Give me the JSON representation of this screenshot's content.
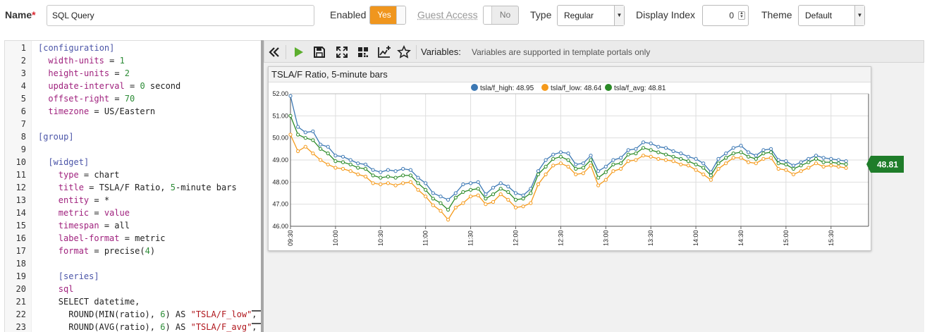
{
  "form": {
    "name_label": "Name",
    "required_mark": "*",
    "name_value": "SQL Query",
    "enabled_label": "Enabled",
    "enabled_value": "Yes",
    "guest_label": "Guest Access",
    "guest_value": "No",
    "type_label": "Type",
    "type_value": "Regular",
    "display_index_label": "Display Index",
    "display_index_value": "0",
    "theme_label": "Theme",
    "theme_value": "Default"
  },
  "editor": {
    "lines": [
      {
        "n": "1",
        "indent": 0,
        "parts": [
          {
            "t": "[configuration]",
            "c": "k-sec"
          }
        ]
      },
      {
        "n": "2",
        "indent": 1,
        "parts": [
          {
            "t": "width-units",
            "c": "k-key"
          },
          {
            "t": " = ",
            "c": ""
          },
          {
            "t": "1",
            "c": "k-num"
          }
        ]
      },
      {
        "n": "3",
        "indent": 1,
        "parts": [
          {
            "t": "height-units",
            "c": "k-key"
          },
          {
            "t": " = ",
            "c": ""
          },
          {
            "t": "2",
            "c": "k-num"
          }
        ]
      },
      {
        "n": "4",
        "indent": 1,
        "parts": [
          {
            "t": "update-interval",
            "c": "k-key"
          },
          {
            "t": " = ",
            "c": ""
          },
          {
            "t": "0",
            "c": "k-num"
          },
          {
            "t": " second",
            "c": ""
          }
        ]
      },
      {
        "n": "5",
        "indent": 1,
        "parts": [
          {
            "t": "offset-right",
            "c": "k-key"
          },
          {
            "t": " = ",
            "c": ""
          },
          {
            "t": "70",
            "c": "k-num"
          }
        ]
      },
      {
        "n": "6",
        "indent": 1,
        "parts": [
          {
            "t": "timezone",
            "c": "k-key"
          },
          {
            "t": " = US/Eastern",
            "c": ""
          }
        ]
      },
      {
        "n": "7",
        "indent": 0,
        "parts": []
      },
      {
        "n": "8",
        "indent": 0,
        "parts": [
          {
            "t": "[group]",
            "c": "k-sec"
          }
        ]
      },
      {
        "n": "9",
        "indent": 0,
        "parts": []
      },
      {
        "n": "10",
        "indent": 1,
        "parts": [
          {
            "t": "[widget]",
            "c": "k-sec"
          }
        ]
      },
      {
        "n": "11",
        "indent": 2,
        "parts": [
          {
            "t": "type",
            "c": "k-key"
          },
          {
            "t": " = chart",
            "c": ""
          }
        ]
      },
      {
        "n": "12",
        "indent": 2,
        "parts": [
          {
            "t": "title",
            "c": "k-key"
          },
          {
            "t": " = TSLA/F Ratio, ",
            "c": ""
          },
          {
            "t": "5",
            "c": "k-num"
          },
          {
            "t": "-minute bars",
            "c": ""
          }
        ]
      },
      {
        "n": "13",
        "indent": 2,
        "parts": [
          {
            "t": "entity",
            "c": "k-key"
          },
          {
            "t": " = *",
            "c": ""
          }
        ]
      },
      {
        "n": "14",
        "indent": 2,
        "parts": [
          {
            "t": "metric",
            "c": "k-key"
          },
          {
            "t": " = ",
            "c": ""
          },
          {
            "t": "value",
            "c": "k-kw"
          }
        ]
      },
      {
        "n": "15",
        "indent": 2,
        "parts": [
          {
            "t": "timespan",
            "c": "k-key"
          },
          {
            "t": " = all",
            "c": ""
          }
        ]
      },
      {
        "n": "16",
        "indent": 2,
        "parts": [
          {
            "t": "label-format",
            "c": "k-key"
          },
          {
            "t": " = metric",
            "c": ""
          }
        ]
      },
      {
        "n": "17",
        "indent": 2,
        "parts": [
          {
            "t": "format",
            "c": "k-key"
          },
          {
            "t": " = precise(",
            "c": ""
          },
          {
            "t": "4",
            "c": "k-num"
          },
          {
            "t": ")",
            "c": ""
          }
        ]
      },
      {
        "n": "18",
        "indent": 0,
        "parts": []
      },
      {
        "n": "19",
        "indent": 2,
        "parts": [
          {
            "t": "[series]",
            "c": "k-sec"
          }
        ]
      },
      {
        "n": "20",
        "indent": 2,
        "parts": [
          {
            "t": "sql",
            "c": "k-key"
          }
        ]
      },
      {
        "n": "21",
        "indent": 2,
        "parts": [
          {
            "t": "SELECT datetime,",
            "c": ""
          }
        ]
      },
      {
        "n": "22",
        "indent": 3,
        "parts": [
          {
            "t": "ROUND(MIN(ratio), ",
            "c": ""
          },
          {
            "t": "6",
            "c": "k-num"
          },
          {
            "t": ") AS ",
            "c": ""
          },
          {
            "t": "\"TSLA/F_low\"",
            "c": "k-str"
          },
          {
            "t": ",",
            "c": ""
          }
        ]
      },
      {
        "n": "23",
        "indent": 3,
        "parts": [
          {
            "t": "ROUND(AVG(ratio), ",
            "c": ""
          },
          {
            "t": "6",
            "c": "k-num"
          },
          {
            "t": ") AS ",
            "c": ""
          },
          {
            "t": "\"TSLA/F_avg\"",
            "c": "k-str"
          },
          {
            "t": ",",
            "c": ""
          }
        ]
      }
    ]
  },
  "toolbar": {
    "icons": [
      "collapse-icon",
      "play-icon",
      "save-icon",
      "fullscreen-icon",
      "grid-icon",
      "add-series-icon",
      "star-icon"
    ],
    "variables_label": "Variables:",
    "variables_hint": "Variables are supported in template portals only"
  },
  "widget": {
    "title": "TSLA/F Ratio, 5-minute bars",
    "current_badge": "48.81"
  },
  "colors": {
    "high": "#3c78b4",
    "low": "#f59a1b",
    "avg": "#2a8a26",
    "accent": "#f0961e"
  },
  "chart_data": {
    "type": "line",
    "title": "TSLA/F Ratio, 5-minute bars",
    "ylim": [
      46.0,
      52.0
    ],
    "yticks": [
      "46.00",
      "47.00",
      "48.00",
      "49.00",
      "50.00",
      "51.00",
      "52.00"
    ],
    "xticks": [
      "09:30",
      "10:00",
      "10:30",
      "11:00",
      "11:30",
      "12:00",
      "12:30",
      "13:00",
      "13:30",
      "14:00",
      "14:30",
      "15:00",
      "15:30"
    ],
    "x_start": "09:30",
    "x_step_minutes": 5,
    "x_end": "15:55",
    "grid": true,
    "legend_position": "top-center",
    "legend": [
      {
        "name": "tsla/f_high",
        "label": "tsla/f_high: 48.95",
        "color": "#3c78b4"
      },
      {
        "name": "tsla/f_low",
        "label": "tsla/f_low: 48.64",
        "color": "#f59a1b"
      },
      {
        "name": "tsla/f_avg",
        "label": "tsla/f_avg: 48.81",
        "color": "#2a8a26"
      }
    ],
    "series": [
      {
        "name": "tsla/f_high",
        "color": "#3c78b4",
        "values": [
          51.9,
          50.5,
          50.25,
          50.3,
          49.7,
          49.6,
          49.2,
          49.15,
          49.0,
          48.85,
          48.8,
          48.55,
          48.45,
          48.55,
          48.5,
          48.6,
          48.55,
          48.2,
          47.95,
          47.5,
          47.35,
          47.2,
          47.5,
          47.9,
          47.95,
          48.0,
          47.45,
          47.75,
          47.95,
          47.8,
          47.5,
          47.4,
          47.7,
          48.5,
          49.0,
          49.25,
          49.35,
          49.3,
          48.8,
          48.85,
          49.2,
          48.5,
          48.7,
          49.0,
          49.1,
          49.45,
          49.5,
          49.8,
          49.75,
          49.6,
          49.55,
          49.4,
          49.3,
          49.15,
          49.05,
          48.85,
          48.45,
          49.05,
          49.3,
          49.55,
          49.65,
          49.35,
          49.2,
          49.45,
          49.5,
          49.0,
          48.95,
          48.75,
          48.9,
          49.05,
          49.2,
          49.1,
          49.05,
          49.0,
          48.95
        ]
      },
      {
        "name": "tsla/f_avg",
        "color": "#2a8a26",
        "values": [
          51.0,
          50.15,
          50.0,
          49.9,
          49.5,
          49.3,
          48.95,
          48.9,
          48.8,
          48.65,
          48.6,
          48.3,
          48.2,
          48.25,
          48.2,
          48.3,
          48.3,
          47.95,
          47.65,
          47.25,
          47.05,
          46.75,
          47.3,
          47.55,
          47.65,
          47.7,
          47.25,
          47.45,
          47.7,
          47.55,
          47.2,
          47.25,
          47.5,
          48.35,
          48.7,
          49.05,
          49.15,
          49.0,
          48.6,
          48.65,
          49.0,
          48.2,
          48.45,
          48.8,
          48.85,
          49.25,
          49.3,
          49.55,
          49.45,
          49.35,
          49.25,
          49.15,
          49.05,
          48.95,
          48.8,
          48.65,
          48.3,
          48.85,
          49.1,
          49.3,
          49.35,
          49.15,
          49.05,
          49.3,
          49.35,
          48.85,
          48.8,
          48.6,
          48.75,
          48.9,
          49.05,
          48.9,
          48.9,
          48.85,
          48.81
        ]
      },
      {
        "name": "tsla/f_low",
        "color": "#f59a1b",
        "values": [
          50.15,
          49.4,
          49.6,
          49.3,
          49.0,
          48.8,
          48.65,
          48.6,
          48.5,
          48.35,
          48.25,
          47.95,
          47.9,
          47.95,
          47.85,
          47.95,
          48.0,
          47.65,
          47.35,
          46.95,
          46.7,
          46.3,
          46.85,
          47.05,
          47.35,
          47.4,
          47.0,
          47.1,
          47.45,
          47.2,
          46.85,
          46.9,
          47.05,
          47.9,
          48.35,
          48.75,
          48.85,
          48.7,
          48.35,
          48.4,
          48.75,
          47.85,
          48.1,
          48.5,
          48.6,
          48.95,
          49.0,
          49.2,
          49.15,
          49.05,
          49.0,
          48.95,
          48.8,
          48.75,
          48.55,
          48.35,
          48.1,
          48.6,
          48.85,
          49.1,
          49.1,
          48.9,
          48.85,
          49.05,
          49.1,
          48.6,
          48.55,
          48.35,
          48.5,
          48.65,
          48.85,
          48.7,
          48.75,
          48.7,
          48.64
        ]
      }
    ]
  }
}
